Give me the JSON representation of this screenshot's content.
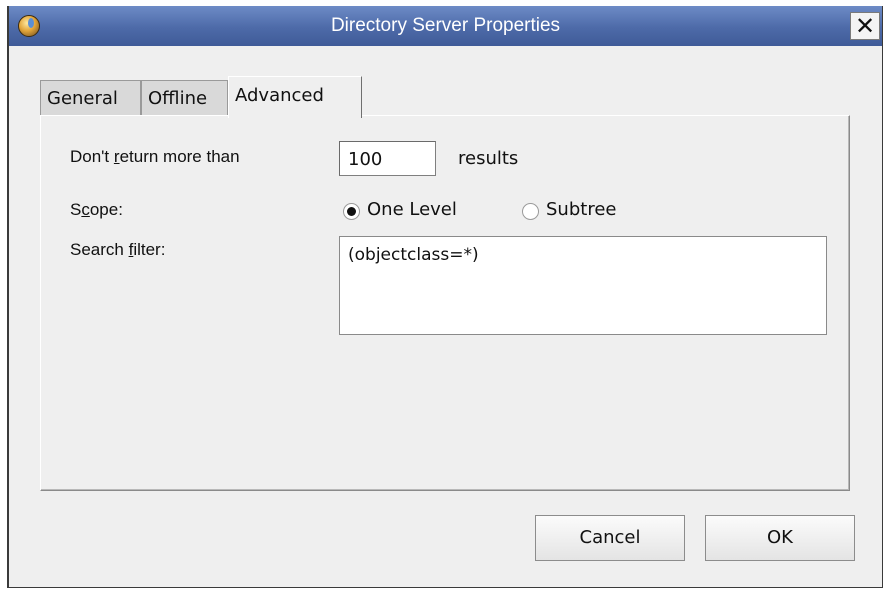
{
  "window": {
    "title": "Directory Server Properties",
    "close_glyph": "✕"
  },
  "tabs": [
    {
      "label": "General",
      "selected": false
    },
    {
      "label": "Offline",
      "selected": false
    },
    {
      "label": "Advanced",
      "selected": true
    }
  ],
  "form": {
    "return_label_pre": "Don't ",
    "return_label_mnemonic": "r",
    "return_label_post": "eturn more than",
    "max_results": "100",
    "results_suffix": "results",
    "scope_label_pre": "S",
    "scope_label_mnemonic": "c",
    "scope_label_post": "ope:",
    "scope_options": [
      {
        "label": "One Level",
        "checked": true
      },
      {
        "label": "Subtree",
        "checked": false
      }
    ],
    "filter_label_pre": "Search ",
    "filter_label_mnemonic": "f",
    "filter_label_post": "ilter:",
    "filter_value": "(objectclass=*)"
  },
  "buttons": {
    "cancel": "Cancel",
    "ok": "OK"
  },
  "icons": {
    "app": "directory-server-icon",
    "close": "close-icon"
  },
  "colors": {
    "titlebar": "#4d6aa8",
    "dialog_bg": "#efefef"
  }
}
